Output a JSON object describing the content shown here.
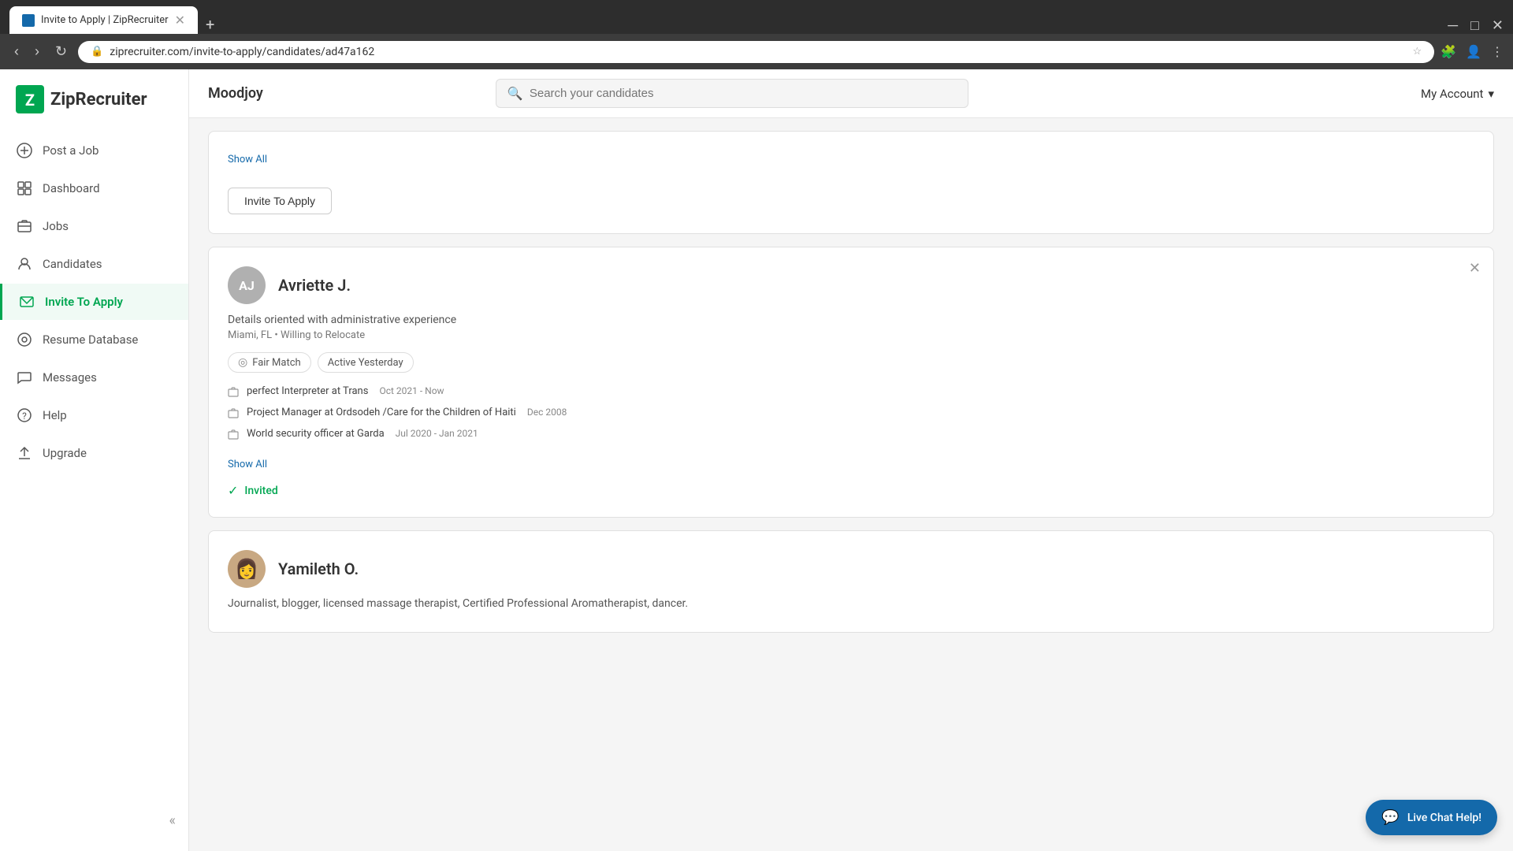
{
  "browser": {
    "tab_title": "Invite to Apply | ZipRecruiter",
    "url": "ziprecruiter.com/invite-to-apply/candidates/ad47a162",
    "nav": {
      "back": "‹",
      "forward": "›",
      "refresh": "↻"
    }
  },
  "sidebar": {
    "logo_text": "ZipRecruiter",
    "items": [
      {
        "id": "post-job",
        "label": "Post a Job",
        "icon": "+"
      },
      {
        "id": "dashboard",
        "label": "Dashboard",
        "icon": "⊡"
      },
      {
        "id": "jobs",
        "label": "Jobs",
        "icon": "≡"
      },
      {
        "id": "candidates",
        "label": "Candidates",
        "icon": "👤"
      },
      {
        "id": "invite-to-apply",
        "label": "Invite To Apply",
        "icon": "✉",
        "active": true
      },
      {
        "id": "resume-database",
        "label": "Resume Database",
        "icon": "🔍"
      },
      {
        "id": "messages",
        "label": "Messages",
        "icon": "💬"
      },
      {
        "id": "help",
        "label": "Help",
        "icon": "?"
      },
      {
        "id": "upgrade",
        "label": "Upgrade",
        "icon": "⬆"
      }
    ]
  },
  "topbar": {
    "job_title": "Moodjoy",
    "search_placeholder": "Search your candidates",
    "my_account": "My Account"
  },
  "cards": [
    {
      "id": "previous-card",
      "show_invite_btn": true,
      "invite_btn_label": "Invite To Apply"
    },
    {
      "id": "avriette-j",
      "initials": "AJ",
      "name": "Avriette J.",
      "tagline": "Details oriented with administrative experience",
      "location": "Miami, FL • Willing to Relocate",
      "badges": [
        {
          "label": "Fair Match",
          "icon": "◎"
        },
        {
          "label": "Active Yesterday"
        }
      ],
      "work_history": [
        {
          "role": "perfect Interpreter at Trans",
          "date": "Oct 2021 - Now"
        },
        {
          "role": "Project Manager at Ordsodeh /Care for the Children of Haiti",
          "date": "Dec 2008"
        },
        {
          "role": "World security officer at Garda",
          "date": "Jul 2020 - Jan 2021"
        }
      ],
      "show_all": "Show All",
      "status": "invited",
      "status_label": "Invited"
    },
    {
      "id": "yamileth-o",
      "name": "Yamileth O.",
      "has_photo": true,
      "tagline": "Journalist, blogger, licensed massage therapist, Certified Professional Aromatherapist, dancer.",
      "location": ""
    }
  ],
  "live_chat": {
    "label": "Live Chat Help!"
  }
}
